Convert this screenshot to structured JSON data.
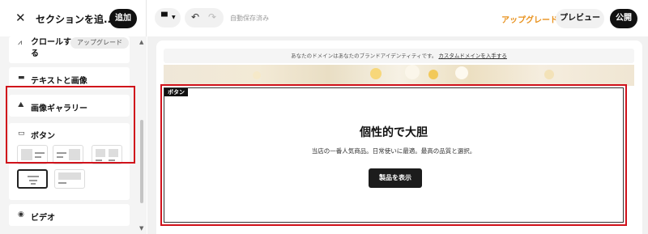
{
  "panel": {
    "close_icon": "close-icon",
    "title": "セクションを追...",
    "add_label": "追加",
    "items": {
      "scroll": {
        "label": "クロールする",
        "badge": "アップグレード",
        "icon": "scroll-icon"
      },
      "text_image": {
        "label": "テキストと画像",
        "icon": "text-image-icon"
      },
      "gallery": {
        "label": "画像ギャラリー",
        "icon": "gallery-icon"
      },
      "button": {
        "label": "ボタン",
        "icon": "button-icon"
      },
      "video": {
        "label": "ビデオ",
        "icon": "video-icon"
      }
    }
  },
  "toolbar": {
    "device_icon": "desktop-icon",
    "autosave": "自動保存済み",
    "upgrade_label": "アップグレード",
    "preview_label": "プレビュー",
    "publish_label": "公開"
  },
  "canvas": {
    "banner_text": "あなたのドメインはあなたのブランドアイデンティティです。",
    "banner_link": "カスタムドメインを入手する",
    "section": {
      "tag": "ボタン",
      "title": "個性的で大胆",
      "subtitle": "当店の一番人気商品。日常使いに最適。最高の品質と選択。",
      "cta": "製品を表示"
    }
  },
  "colors": {
    "accent_upgrade": "#e8911c",
    "highlight_red": "#d0121b",
    "primary_dark": "#111111"
  }
}
